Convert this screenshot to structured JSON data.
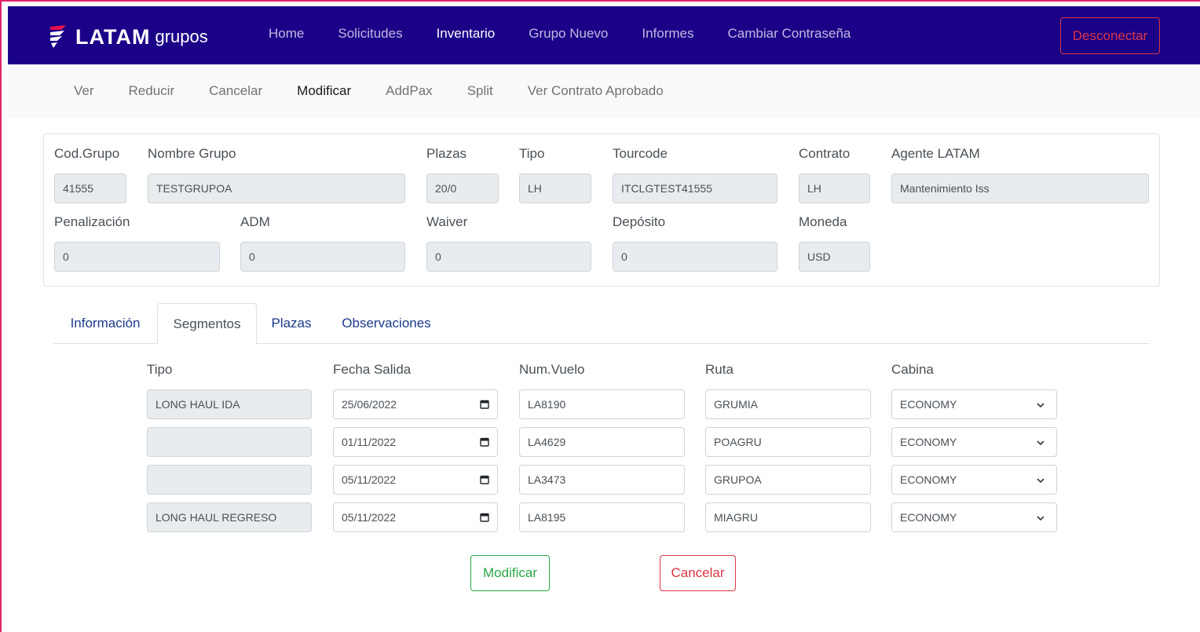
{
  "brand": {
    "latam": "LATAM",
    "grupos": "grupos"
  },
  "nav": {
    "items": [
      "Home",
      "Solicitudes",
      "Inventario",
      "Grupo Nuevo",
      "Informes",
      "Cambiar Contraseña"
    ],
    "active": "Inventario",
    "logout_label": "Desconectar"
  },
  "subnav": {
    "items": [
      "Ver",
      "Reducir",
      "Cancelar",
      "Modificar",
      "AddPax",
      "Split",
      "Ver Contrato Aprobado"
    ],
    "active": "Modificar"
  },
  "group": {
    "cod_grupo": {
      "label": "Cod.Grupo",
      "value": "41555"
    },
    "nombre_grupo": {
      "label": "Nombre Grupo",
      "value": "TESTGRUPOA"
    },
    "plazas": {
      "label": "Plazas",
      "value": "20/0"
    },
    "tipo": {
      "label": "Tipo",
      "value": "LH"
    },
    "tourcode": {
      "label": "Tourcode",
      "value": "ITCLGTEST41555"
    },
    "contrato": {
      "label": "Contrato",
      "value": "LH"
    },
    "agente": {
      "label": "Agente LATAM",
      "value": "Mantenimiento Iss"
    },
    "penalizacion": {
      "label": "Penalización",
      "value": "0"
    },
    "adm": {
      "label": "ADM",
      "value": "0"
    },
    "waiver": {
      "label": "Waiver",
      "value": "0"
    },
    "deposito": {
      "label": "Depósito",
      "value": "0"
    },
    "moneda": {
      "label": "Moneda",
      "value": "USD"
    }
  },
  "tabs": {
    "items": [
      "Información",
      "Segmentos",
      "Plazas",
      "Observaciones"
    ],
    "active": "Segmentos"
  },
  "segments": {
    "headers": [
      "Tipo",
      "Fecha Salida",
      "Num.Vuelo",
      "Ruta",
      "Cabina"
    ],
    "rows": [
      {
        "tipo": "LONG HAUL IDA",
        "fecha": "25/06/2022",
        "vuelo": "LA8190",
        "ruta": "GRUMIA",
        "cabina": "ECONOMY"
      },
      {
        "tipo": "",
        "fecha": "01/11/2022",
        "vuelo": "LA4629",
        "ruta": "POAGRU",
        "cabina": "ECONOMY"
      },
      {
        "tipo": "",
        "fecha": "05/11/2022",
        "vuelo": "LA3473",
        "ruta": "GRUPOA",
        "cabina": "ECONOMY"
      },
      {
        "tipo": "LONG HAUL REGRESO",
        "fecha": "05/11/2022",
        "vuelo": "LA8195",
        "ruta": "MIAGRU",
        "cabina": "ECONOMY"
      }
    ]
  },
  "actions": {
    "modificar_label": "Modificar",
    "cancelar_label": "Cancelar"
  },
  "colors": {
    "navbar": "#1b0088",
    "accent_red": "#dc3545",
    "accent_green": "#28a745",
    "frame": "#e0236b"
  }
}
